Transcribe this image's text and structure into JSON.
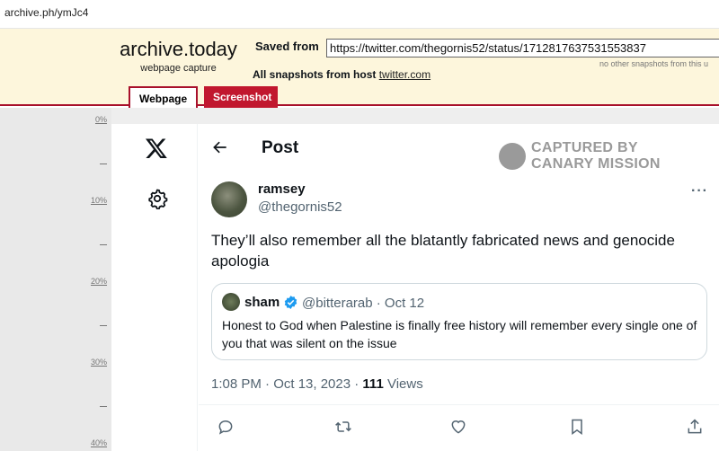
{
  "browser": {
    "url": "archive.ph/ymJc4"
  },
  "archive": {
    "brand_title": "archive.today",
    "brand_subtitle": "webpage capture",
    "saved_from_label": "Saved from",
    "saved_from_url": "https://twitter.com/thegornis52/status/1712817637531553837",
    "no_snapshots": "no other snapshots from this u",
    "all_snapshots_label": "All snapshots",
    "from_host_label": "from host",
    "host_link": "twitter.com",
    "tabs": {
      "webpage": "Webpage",
      "screenshot": "Screenshot"
    },
    "colors": {
      "header_bg": "#fdf6dc",
      "accent": "#a8102b"
    }
  },
  "ruler": {
    "labels": [
      "0%",
      "10%",
      "20%",
      "30%",
      "40%"
    ]
  },
  "tweet": {
    "page_title": "Post",
    "watermark_line1": "CAPTURED BY",
    "watermark_line2": "CANARY MISSION",
    "author_name": "ramsey",
    "author_handle": "@thegornis52",
    "text": "They’ll also remember all the blatantly fabricated news and genocide apologia",
    "quote": {
      "name": "sham",
      "handle_date": "@bitterarab · Oct 12",
      "text": "Honest to God when Palestine is finally free history will remember every single one of you that was silent on the issue"
    },
    "timestamp": "1:08 PM · Oct 13, 2023 · ",
    "views_count": "111",
    "views_label": " Views",
    "more_label": "···"
  }
}
